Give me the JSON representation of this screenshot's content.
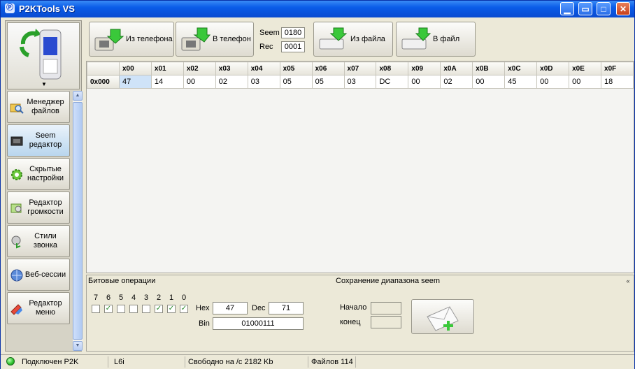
{
  "window": {
    "title": "P2KTools VS",
    "icon": "app-icon"
  },
  "titlebar_buttons": [
    "minimize-icon",
    "restore-icon",
    "maximize-icon",
    "close-icon"
  ],
  "sidebar": {
    "items": [
      {
        "label": "Менеджер файлов",
        "icon": "folder-search-icon"
      },
      {
        "label": "Seem редактор",
        "icon": "chip-editor-icon",
        "active": true
      },
      {
        "label": "Скрытые настройки",
        "icon": "gear-icon"
      },
      {
        "label": "Редактор громкости",
        "icon": "speaker-icon"
      },
      {
        "label": "Стили звонка",
        "icon": "ringtone-icon"
      },
      {
        "label": "Веб-сессии",
        "icon": "globe-icon"
      },
      {
        "label": "Редактор меню",
        "icon": "menu-editor-icon"
      }
    ]
  },
  "toolbar": {
    "from_phone": "Из телефона",
    "to_phone": "В телефон",
    "seem_label": "Seem",
    "seem_value": "0180",
    "rec_label": "Rec",
    "rec_value": "0001",
    "from_file": "Из файла",
    "to_file": "В файл"
  },
  "grid": {
    "columns": [
      "x00",
      "x01",
      "x02",
      "x03",
      "x04",
      "x05",
      "x06",
      "x07",
      "x08",
      "x09",
      "x0A",
      "x0B",
      "x0C",
      "x0D",
      "x0E",
      "x0F"
    ],
    "rows": [
      {
        "offset": "0x000",
        "values": [
          "47",
          "14",
          "00",
          "02",
          "03",
          "05",
          "05",
          "03",
          "DC",
          "00",
          "02",
          "00",
          "45",
          "00",
          "00",
          "18"
        ]
      }
    ]
  },
  "bit_ops": {
    "title": "Битовые операции",
    "bits": [
      "7",
      "6",
      "5",
      "4",
      "3",
      "2",
      "1",
      "0"
    ],
    "checked": [
      false,
      true,
      false,
      false,
      false,
      true,
      true,
      true
    ],
    "hex_label": "Hex",
    "hex_value": "47",
    "dec_label": "Dec",
    "dec_value": "71",
    "bin_label": "Bin",
    "bin_value": "01000111"
  },
  "save_range": {
    "title": "Сохранение диапазона seem",
    "start_label": "Начало",
    "end_label": "конец"
  },
  "status": {
    "connection": "Подключен P2K",
    "model": "L6i",
    "free_space": "Свободно на /c 2182 Kb",
    "files": "Файлов 114"
  }
}
